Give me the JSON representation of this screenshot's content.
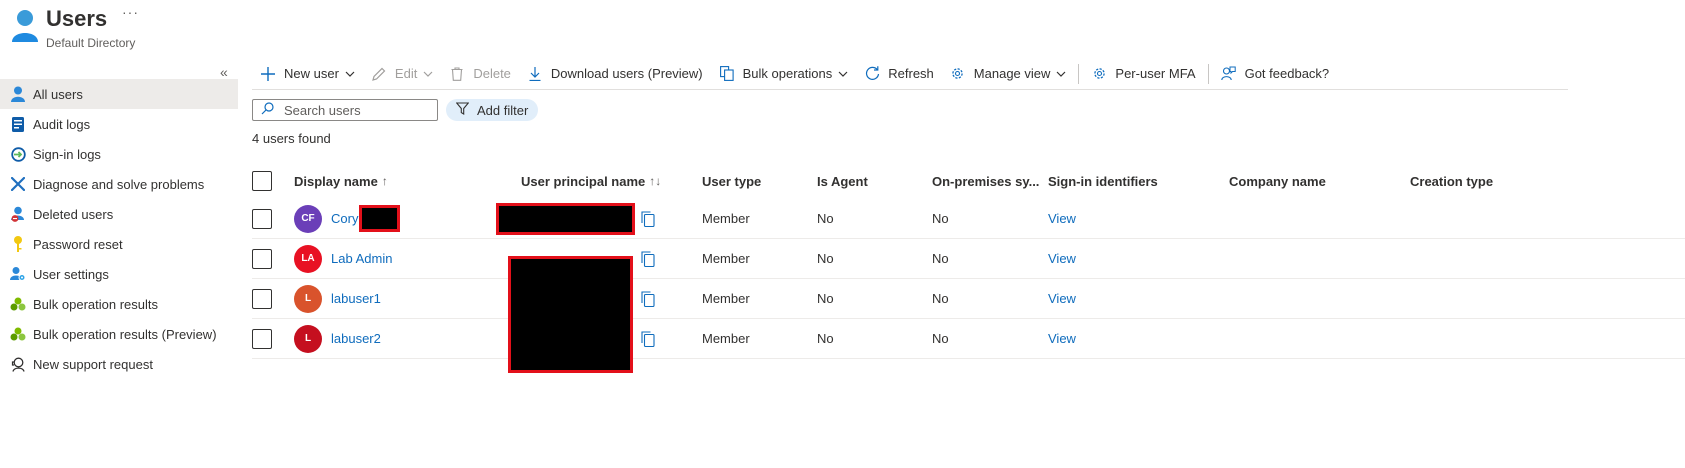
{
  "header": {
    "title": "Users",
    "subtitle": "Default Directory",
    "more": "···"
  },
  "sidebar": {
    "collapse": "«",
    "items": [
      {
        "label": "All users",
        "icon": "user-icon",
        "active": true
      },
      {
        "label": "Audit logs",
        "icon": "audit-log-icon"
      },
      {
        "label": "Sign-in logs",
        "icon": "sign-in-log-icon"
      },
      {
        "label": "Diagnose and solve problems",
        "icon": "wrench-icon"
      },
      {
        "label": "Deleted users",
        "icon": "deleted-user-icon"
      },
      {
        "label": "Password reset",
        "icon": "key-icon"
      },
      {
        "label": "User settings",
        "icon": "user-settings-icon"
      },
      {
        "label": "Bulk operation results",
        "icon": "bulk-results-icon"
      },
      {
        "label": "Bulk operation results (Preview)",
        "icon": "bulk-results-icon"
      },
      {
        "label": "New support request",
        "icon": "support-request-icon"
      }
    ]
  },
  "toolbar": {
    "new_user": "New user",
    "edit": "Edit",
    "delete": "Delete",
    "download": "Download users (Preview)",
    "bulk": "Bulk operations",
    "refresh": "Refresh",
    "manage_view": "Manage view",
    "mfa": "Per-user MFA",
    "feedback": "Got feedback?"
  },
  "search": {
    "placeholder": "Search users"
  },
  "filter": {
    "label": "Add filter"
  },
  "result_count": "4 users found",
  "table": {
    "columns": {
      "display_name": "Display name",
      "display_name_sort": "↑",
      "upn": "User principal name",
      "upn_sort": "↑↓",
      "user_type": "User type",
      "is_agent": "Is Agent",
      "on_prem": "On-premises sy...",
      "sign_in": "Sign-in identifiers",
      "company": "Company name",
      "creation": "Creation type"
    },
    "rows": [
      {
        "initials": "CF",
        "avatar_color": "#6b3fb8",
        "name": "Cory",
        "user_type": "Member",
        "is_agent": "No",
        "on_prem": "No",
        "sign_in": "View",
        "company": "",
        "creation": ""
      },
      {
        "initials": "LA",
        "avatar_color": "#e81123",
        "name": "Lab Admin",
        "user_type": "Member",
        "is_agent": "No",
        "on_prem": "No",
        "sign_in": "View",
        "company": "",
        "creation": ""
      },
      {
        "initials": "L",
        "avatar_color": "#d9532c",
        "name": "labuser1",
        "user_type": "Member",
        "is_agent": "No",
        "on_prem": "No",
        "sign_in": "View",
        "company": "",
        "creation": ""
      },
      {
        "initials": "L",
        "avatar_color": "#c50f1f",
        "name": "labuser2",
        "user_type": "Member",
        "is_agent": "No",
        "on_prem": "No",
        "sign_in": "View",
        "company": "",
        "creation": ""
      }
    ]
  },
  "colors": {
    "accent": "#0f6cbd",
    "redaction_border": "#e3101a"
  }
}
